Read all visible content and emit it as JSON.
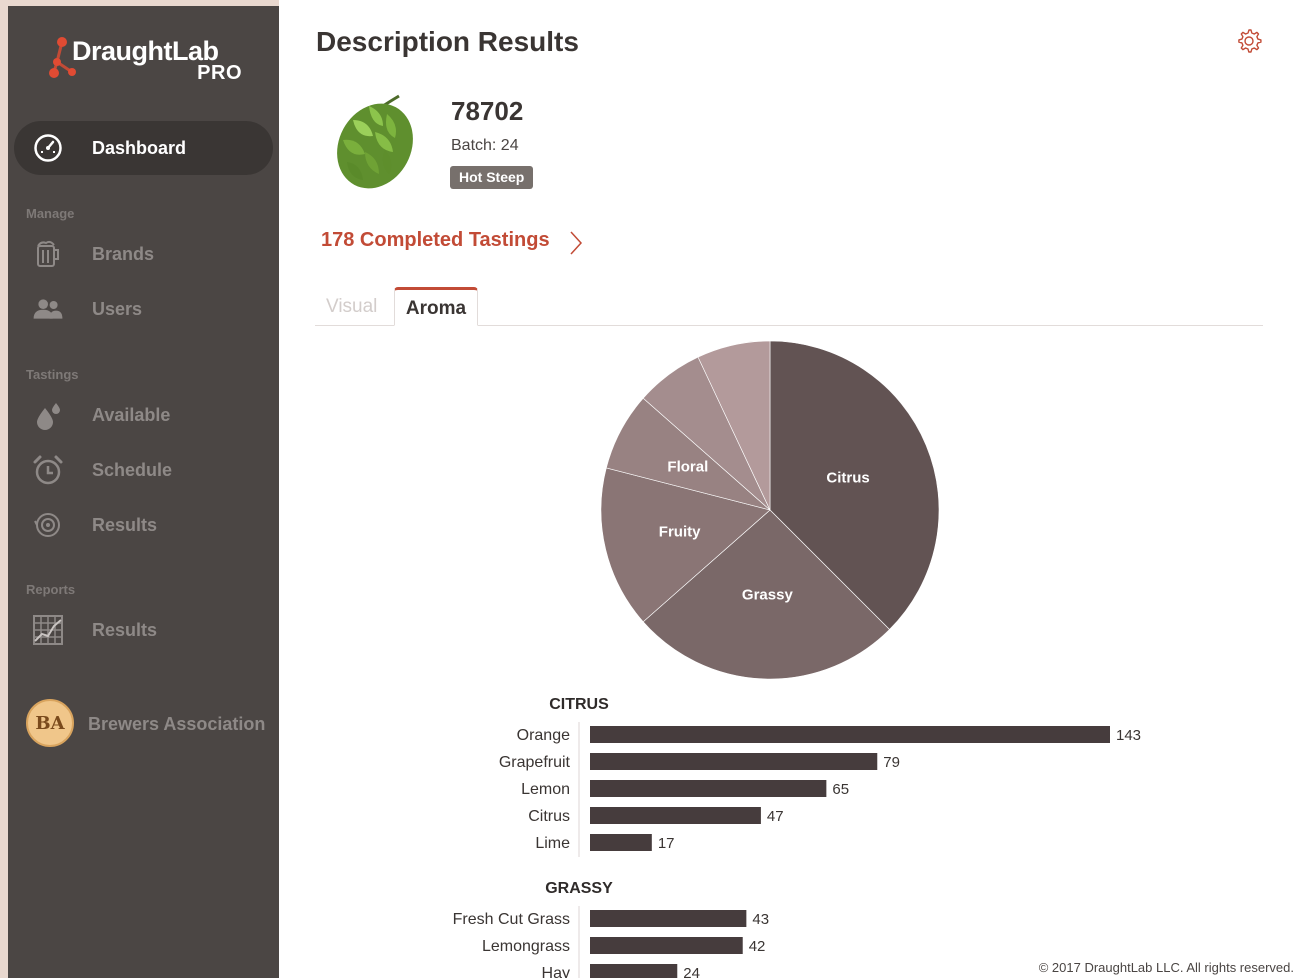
{
  "app": {
    "logo_text": "DraughtLab",
    "logo_sub": "PRO"
  },
  "sidebar": {
    "dashboard": {
      "label": "Dashboard",
      "icon": "dashboard-gauge-icon"
    },
    "sections": {
      "manage": "Manage",
      "tastings": "Tastings",
      "reports": "Reports"
    },
    "manage_items": [
      {
        "label": "Brands",
        "icon": "beer-mug-icon"
      },
      {
        "label": "Users",
        "icon": "users-icon"
      }
    ],
    "tastings_items": [
      {
        "label": "Available",
        "icon": "drops-icon"
      },
      {
        "label": "Schedule",
        "icon": "alarm-clock-icon"
      },
      {
        "label": "Results",
        "icon": "results-spiral-icon"
      }
    ],
    "reports_items": [
      {
        "label": "Results",
        "icon": "report-grid-icon"
      }
    ],
    "org": {
      "badge": "BA",
      "label": "Brewers Association"
    }
  },
  "header": {
    "title": "Description Results"
  },
  "sample": {
    "id": "78702",
    "batch": "Batch: 24",
    "badge": "Hot Steep",
    "completed_link": "178 Completed Tastings"
  },
  "tabs": [
    {
      "label": "Visual",
      "active": false
    },
    {
      "label": "Aroma",
      "active": true
    }
  ],
  "colors": {
    "accent": "#c24b36",
    "sidebar": "#4b4644",
    "bar": "#463c3d"
  },
  "chart_data": [
    {
      "type": "pie",
      "slices": [
        {
          "label": "Citrus",
          "value": 37.5,
          "color": "#625353"
        },
        {
          "label": "Grassy",
          "value": 26.0,
          "color": "#7a6868"
        },
        {
          "label": "Fruity",
          "value": 15.5,
          "color": "#8a7575"
        },
        {
          "label": "Floral",
          "value": 7.5,
          "color": "#988282"
        },
        {
          "label": "",
          "value": 6.5,
          "color": "#a48d8e"
        },
        {
          "label": "",
          "value": 7.0,
          "color": "#b39a9b"
        }
      ]
    },
    {
      "type": "bar",
      "orientation": "horizontal",
      "groups": [
        {
          "title": "CITRUS",
          "categories": [
            "Orange",
            "Grapefruit",
            "Lemon",
            "Citrus",
            "Lime"
          ],
          "values": [
            143,
            79,
            65,
            47,
            17
          ]
        },
        {
          "title": "GRASSY",
          "categories": [
            "Fresh Cut Grass",
            "Lemongrass",
            "Hay"
          ],
          "values": [
            43,
            42,
            24
          ]
        }
      ],
      "xlim": [
        0,
        143
      ]
    }
  ],
  "footer": {
    "copyright": "© 2017 DraughtLab LLC. All rights reserved."
  }
}
